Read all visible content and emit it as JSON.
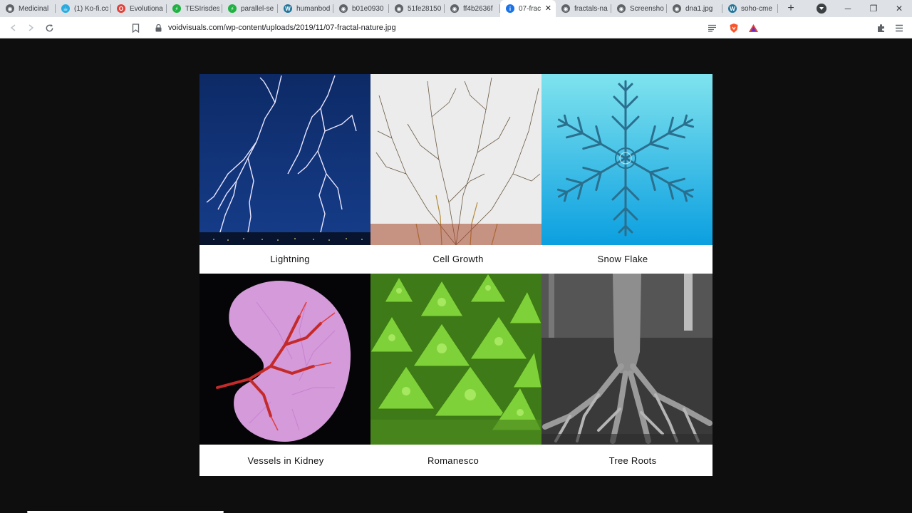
{
  "browser": {
    "tabs": [
      {
        "title": "Medicinal",
        "icon": "globe-icon",
        "color": "#5f6368"
      },
      {
        "title": "(1) Ko-fi.co",
        "icon": "kofi-icon",
        "color": "#29abe0"
      },
      {
        "title": "Evolutiona",
        "icon": "opera-icon",
        "color": "#e0413a"
      },
      {
        "title": "TESIrisdes",
        "icon": "bolt-icon",
        "color": "#1fb141"
      },
      {
        "title": "parallel-se",
        "icon": "bolt-icon",
        "color": "#1fb141"
      },
      {
        "title": "humanbod",
        "icon": "wordpress-icon",
        "color": "#21759b"
      },
      {
        "title": "b01e0930",
        "icon": "globe-icon",
        "color": "#5f6368"
      },
      {
        "title": "51fe28150",
        "icon": "globe-icon",
        "color": "#5f6368"
      },
      {
        "title": "ff4b2636f",
        "icon": "globe-icon",
        "color": "#5f6368"
      },
      {
        "title": "07-frac",
        "icon": "info-icon",
        "color": "#1a73e8",
        "active": true
      },
      {
        "title": "fractals-na",
        "icon": "globe-icon",
        "color": "#5f6368"
      },
      {
        "title": "Screensho",
        "icon": "globe-icon",
        "color": "#5f6368"
      },
      {
        "title": "dna1.jpg",
        "icon": "globe-icon",
        "color": "#5f6368"
      },
      {
        "title": "soho-cme",
        "icon": "wordpress-icon",
        "color": "#21759b"
      }
    ],
    "address_url": "voidvisuals.com/wp-content/uploads/2019/11/07-fractal-nature.jpg",
    "new_tab_glyph": "+",
    "close_glyph": "✕",
    "minimize_glyph": "─",
    "restore_glyph": "❐",
    "window_close_glyph": "✕"
  },
  "image": {
    "captions": [
      "Lightning",
      "Cell Growth",
      "Snow Flake",
      "Vessels in Kidney",
      "Romanesco",
      "Tree Roots"
    ],
    "colors": {
      "lightning_sky": "#0d2a66",
      "snow_sky": "#27b8e6",
      "kidney_bg": "#050507",
      "romanesco": "#7fd13a",
      "roots_gray": "#7a7a7a"
    }
  }
}
